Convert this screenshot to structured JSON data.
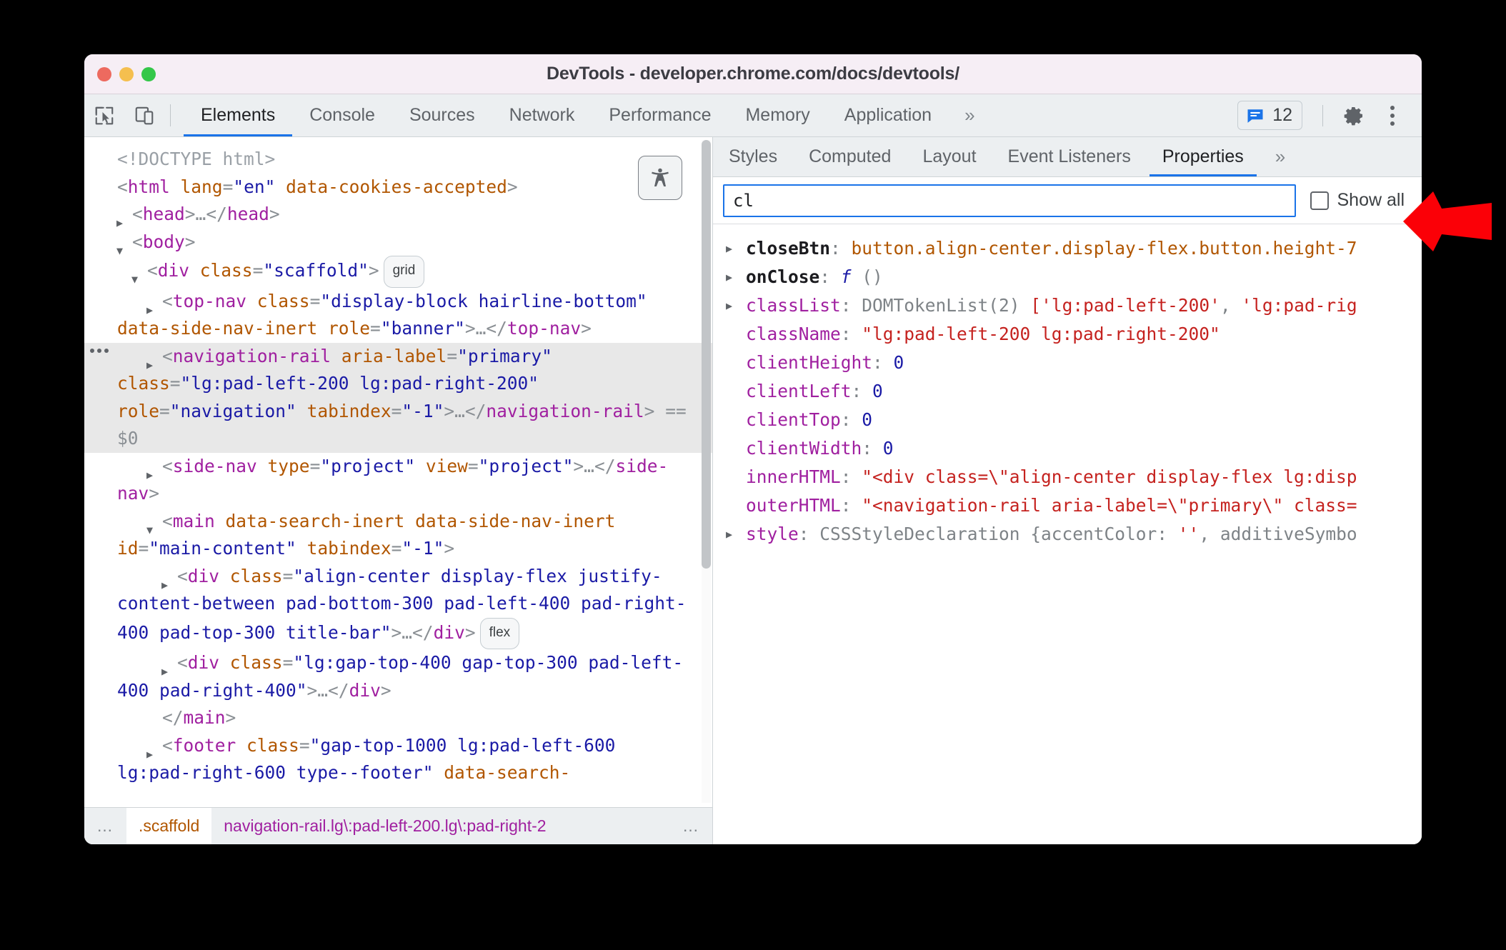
{
  "window": {
    "title": "DevTools - developer.chrome.com/docs/devtools/",
    "traffic_lights": [
      "close-red",
      "minimize-yellow",
      "maximize-green"
    ]
  },
  "toolbar": {
    "inspect_icon": "inspect-cursor-icon",
    "device_icon": "device-toolbar-icon",
    "tabs": [
      {
        "label": "Elements",
        "active": true
      },
      {
        "label": "Console",
        "active": false
      },
      {
        "label": "Sources",
        "active": false
      },
      {
        "label": "Network",
        "active": false
      },
      {
        "label": "Performance",
        "active": false
      },
      {
        "label": "Memory",
        "active": false
      },
      {
        "label": "Application",
        "active": false
      }
    ],
    "more_tabs_label": "»",
    "issues": {
      "icon": "issues-chat-icon",
      "count": "12",
      "accent": "#1a73e8"
    },
    "settings_icon": "gear-icon",
    "menu_icon": "kebab-menu-icon"
  },
  "dom": {
    "a11y_button_icon": "accessibility-icon",
    "lines": [
      {
        "kind": "doctype",
        "text": "<!DOCTYPE html>"
      },
      {
        "kind": "node",
        "indent": 0,
        "twisty": "none",
        "html": "<span class=\"punct\">&lt;</span><span class=\"tag\">html</span> <span class=\"attr\">lang</span><span class=\"punct\">=</span><span class=\"val\">\"en\"</span> <span class=\"attr\">data-cookies-accepted</span><span class=\"punct\">&gt;</span>"
      },
      {
        "kind": "node",
        "indent": 1,
        "twisty": "closed",
        "html": "<span class=\"punct\">&lt;</span><span class=\"tag\">head</span><span class=\"punct\">&gt;</span><span class=\"punct\">…</span><span class=\"punct\">&lt;/</span><span class=\"tag\">head</span><span class=\"punct\">&gt;</span>"
      },
      {
        "kind": "node",
        "indent": 1,
        "twisty": "open",
        "html": "<span class=\"punct\">&lt;</span><span class=\"tag\">body</span><span class=\"punct\">&gt;</span>"
      },
      {
        "kind": "node",
        "indent": 2,
        "twisty": "open",
        "html": "<span class=\"punct\">&lt;</span><span class=\"tag\">div</span> <span class=\"attr\">class</span><span class=\"punct\">=</span><span class=\"val\">\"scaffold\"</span><span class=\"punct\">&gt;</span><span class=\"badge-pill\">grid</span>"
      },
      {
        "kind": "node",
        "indent": 3,
        "twisty": "closed",
        "html": "<span class=\"punct\">&lt;</span><span class=\"tag\">top-nav</span> <span class=\"attr\">class</span><span class=\"punct\">=</span><span class=\"val\">\"display-block hairline-bottom\"</span> <span class=\"attr\">data-side-nav-inert</span> <span class=\"attr\">role</span><span class=\"punct\">=</span><span class=\"val\">\"banner\"</span><span class=\"punct\">&gt;</span><span class=\"punct\">…</span><span class=\"punct\">&lt;/</span><span class=\"tag\">top-nav</span><span class=\"punct\">&gt;</span>"
      },
      {
        "kind": "node",
        "indent": 3,
        "twisty": "closed",
        "selected": true,
        "html": "<span class=\"punct\">&lt;</span><span class=\"tag\">navigation-rail</span> <span class=\"attr\">aria-label</span><span class=\"punct\">=</span><span class=\"val\">\"primary\"</span> <span class=\"attr\">class</span><span class=\"punct\">=</span><span class=\"val\">\"lg:pad-left-200 lg:pad-right-200\"</span> <span class=\"attr\">role</span><span class=\"punct\">=</span><span class=\"val\">\"navigation\"</span> <span class=\"attr\">tabindex</span><span class=\"punct\">=</span><span class=\"val\">\"-1\"</span><span class=\"punct\">&gt;</span><span class=\"punct\">…</span><span class=\"punct\">&lt;/</span><span class=\"tag\">navigation-rail</span><span class=\"punct\">&gt;</span> <span class=\"dollar0\">== $0</span>"
      },
      {
        "kind": "node",
        "indent": 3,
        "twisty": "closed",
        "html": "<span class=\"punct\">&lt;</span><span class=\"tag\">side-nav</span> <span class=\"attr\">type</span><span class=\"punct\">=</span><span class=\"val\">\"project\"</span> <span class=\"attr\">view</span><span class=\"punct\">=</span><span class=\"val\">\"project\"</span><span class=\"punct\">&gt;</span><span class=\"punct\">…</span><span class=\"punct\">&lt;/</span><span class=\"tag\">side-nav</span><span class=\"punct\">&gt;</span>"
      },
      {
        "kind": "node",
        "indent": 3,
        "twisty": "open",
        "html": "<span class=\"punct\">&lt;</span><span class=\"tag\">main</span> <span class=\"attr\">data-search-inert</span> <span class=\"attr\">data-side-nav-inert</span> <span class=\"attr\">id</span><span class=\"punct\">=</span><span class=\"val\">\"main-content\"</span> <span class=\"attr\">tabindex</span><span class=\"punct\">=</span><span class=\"val\">\"-1\"</span><span class=\"punct\">&gt;</span>"
      },
      {
        "kind": "node",
        "indent": 4,
        "twisty": "closed",
        "html": "<span class=\"punct\">&lt;</span><span class=\"tag\">div</span> <span class=\"attr\">class</span><span class=\"punct\">=</span><span class=\"val\">\"align-center display-flex justify-content-between pad-bottom-300 pad-left-400 pad-right-400 pad-top-300 title-bar\"</span><span class=\"punct\">&gt;</span><span class=\"punct\">…</span><span class=\"punct\">&lt;/</span><span class=\"tag\">div</span><span class=\"punct\">&gt;</span><span class=\"badge-pill\">flex</span>"
      },
      {
        "kind": "node",
        "indent": 4,
        "twisty": "closed",
        "html": "<span class=\"punct\">&lt;</span><span class=\"tag\">div</span> <span class=\"attr\">class</span><span class=\"punct\">=</span><span class=\"val\">\"lg:gap-top-400 gap-top-300 pad-left-400 pad-right-400\"</span><span class=\"punct\">&gt;</span><span class=\"punct\">…</span><span class=\"punct\">&lt;/</span><span class=\"tag\">div</span><span class=\"punct\">&gt;</span>"
      },
      {
        "kind": "node",
        "indent": 3,
        "twisty": "none",
        "html": "<span class=\"punct\">&lt;/</span><span class=\"tag\">main</span><span class=\"punct\">&gt;</span>"
      },
      {
        "kind": "node",
        "indent": 3,
        "twisty": "closed",
        "html": "<span class=\"punct\">&lt;</span><span class=\"tag\">footer</span> <span class=\"attr\">class</span><span class=\"punct\">=</span><span class=\"val\">\"gap-top-1000 lg:pad-left-600 lg:pad-right-600 type--footer\"</span> <span class=\"attr\">data-search-</span>"
      }
    ],
    "breadcrumbs": [
      {
        "label": "…",
        "kind": "ellipsis"
      },
      {
        "label": ".scaffold",
        "kind": "selected"
      },
      {
        "label": "navigation-rail.lg\\:pad-left-200.lg\\:pad-right-2",
        "kind": "link"
      },
      {
        "label": "…",
        "kind": "ellipsis"
      }
    ]
  },
  "props": {
    "tabs": [
      {
        "label": "Styles",
        "active": false
      },
      {
        "label": "Computed",
        "active": false
      },
      {
        "label": "Layout",
        "active": false
      },
      {
        "label": "Event Listeners",
        "active": false
      },
      {
        "label": "Properties",
        "active": true
      }
    ],
    "more_tabs_label": "»",
    "filter": {
      "value": "cl",
      "placeholder": ""
    },
    "show_all": {
      "label": "Show all",
      "checked": false
    },
    "rows": [
      {
        "arrow": true,
        "html": "<span class=\"pname own\">closeBtn</span><span class=\"pgrey\">: </span><span class=\"pobj\">button.align-center.display-flex.button.height-7</span>"
      },
      {
        "arrow": true,
        "html": "<span class=\"pname own\">onClose</span><span class=\"pgrey\">: </span><span class=\"pfn\">f</span><span class=\"pgrey\"> ()</span>"
      },
      {
        "arrow": true,
        "html": "<span class=\"pname\">classList</span><span class=\"pgrey\">: </span><span class=\"pgrey\">DOMTokenList(2) </span><span class=\"pstr\">[</span><span class=\"pstr\">'lg:pad-left-200'</span><span class=\"pgrey\">, </span><span class=\"pstr\">'lg:pad-rig</span>"
      },
      {
        "arrow": false,
        "html": "<span class=\"pname\">className</span><span class=\"pgrey\">: </span><span class=\"pstr\">\"lg:pad-left-200 lg:pad-right-200\"</span>"
      },
      {
        "arrow": false,
        "html": "<span class=\"pname\">clientHeight</span><span class=\"pgrey\">: </span><span class=\"pnum\">0</span>"
      },
      {
        "arrow": false,
        "html": "<span class=\"pname\">clientLeft</span><span class=\"pgrey\">: </span><span class=\"pnum\">0</span>"
      },
      {
        "arrow": false,
        "html": "<span class=\"pname\">clientTop</span><span class=\"pgrey\">: </span><span class=\"pnum\">0</span>"
      },
      {
        "arrow": false,
        "html": "<span class=\"pname\">clientWidth</span><span class=\"pgrey\">: </span><span class=\"pnum\">0</span>"
      },
      {
        "arrow": false,
        "html": "<span class=\"pname\">innerHTML</span><span class=\"pgrey\">: </span><span class=\"pstr\">\"&lt;div class=\\\"align-center display-flex lg:disp</span>"
      },
      {
        "arrow": false,
        "html": "<span class=\"pname\">outerHTML</span><span class=\"pgrey\">: </span><span class=\"pstr\">\"&lt;navigation-rail aria-label=\\\"primary\\\" class=</span>"
      },
      {
        "arrow": true,
        "html": "<span class=\"pname\">style</span><span class=\"pgrey\">: </span><span class=\"pgrey\">CSSStyleDeclaration {accentColor: </span><span class=\"pstr\">''</span><span class=\"pgrey\">, additiveSymbo</span>"
      }
    ]
  },
  "annotation": {
    "arrow": "left-pointing-arrow",
    "color": "#fb0007"
  }
}
